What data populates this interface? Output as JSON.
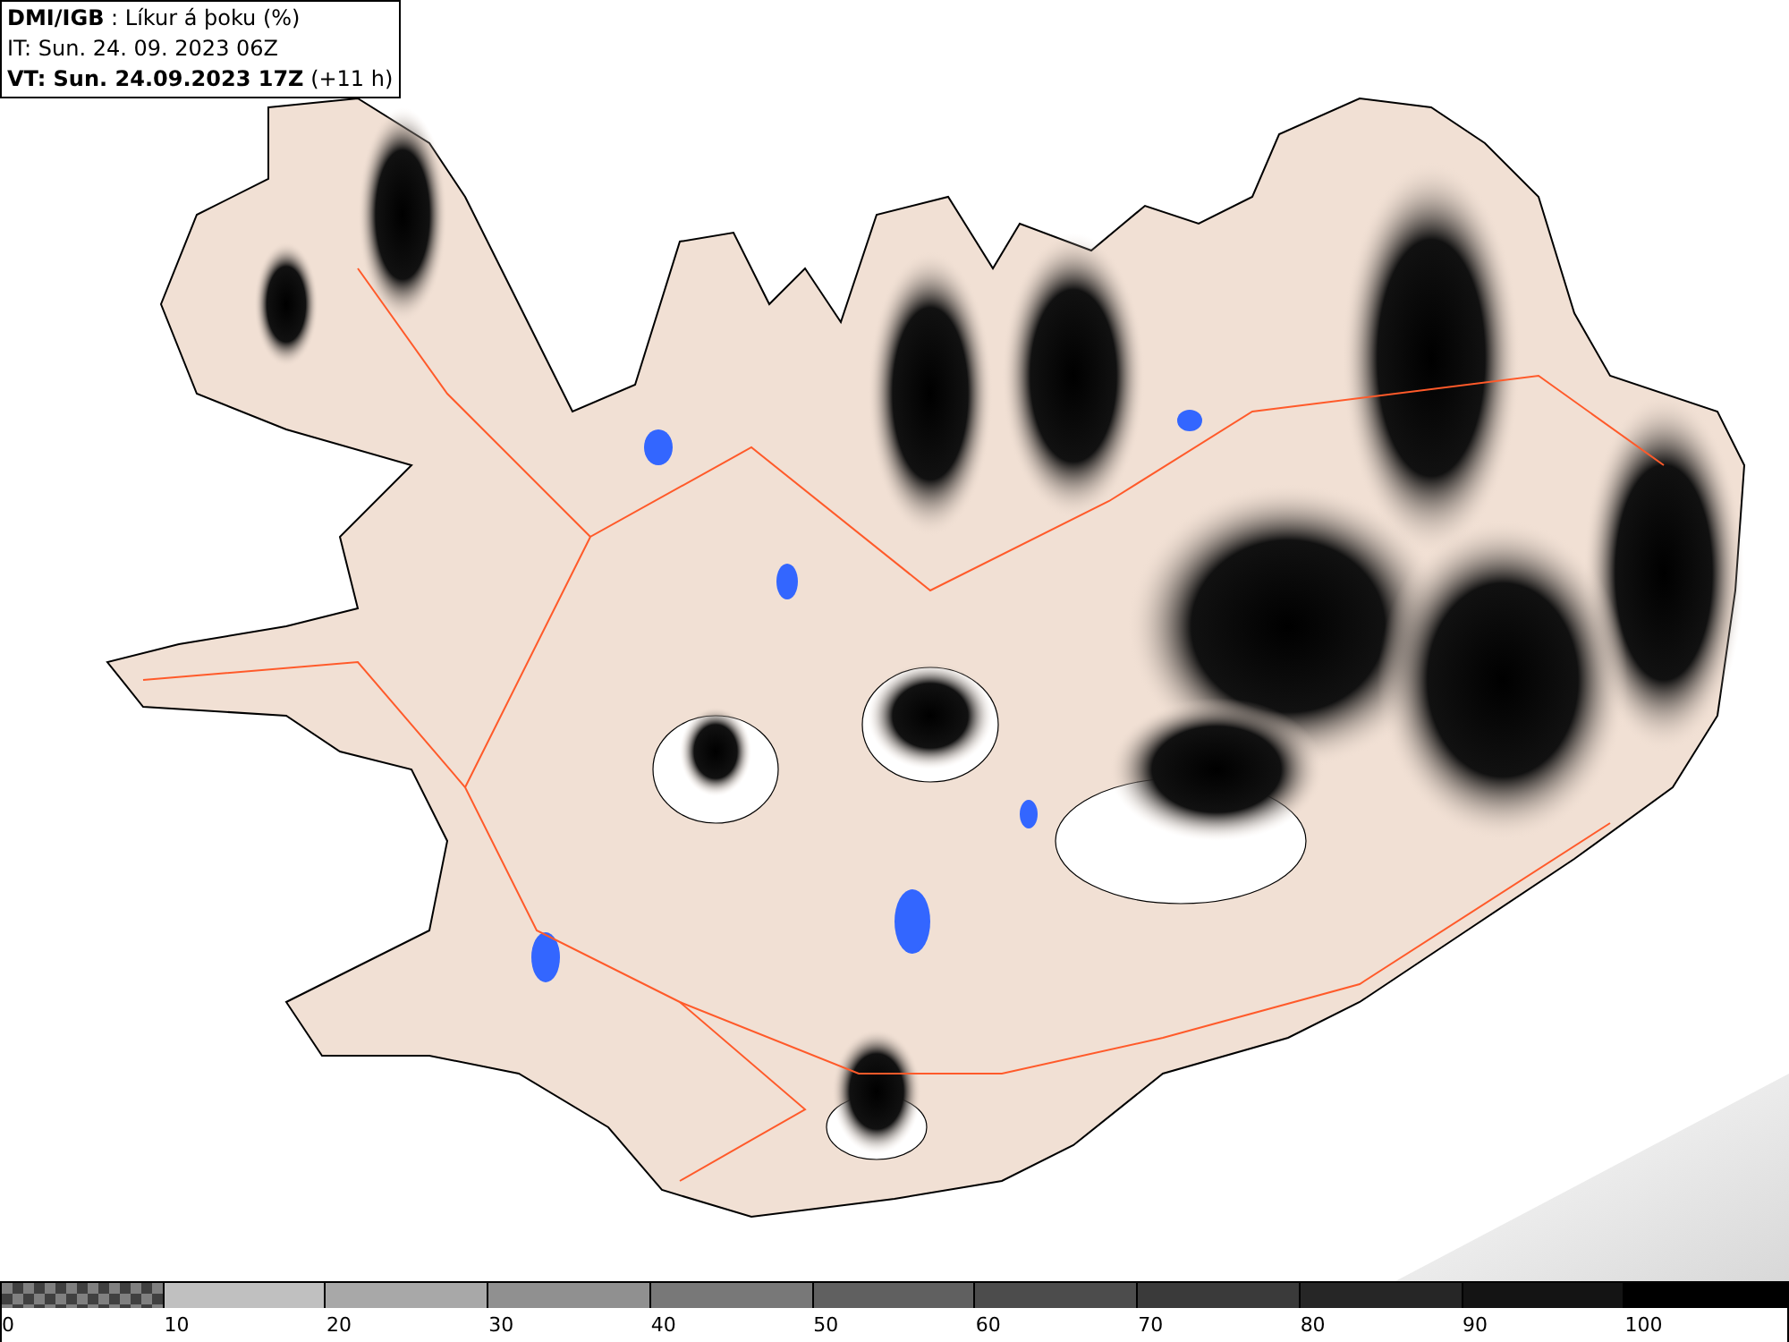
{
  "header": {
    "lines": [
      "**DMI/IGB** : Líkur á þoku (%)",
      "IT: Sun. 24. 09. 2023 06Z",
      "**VT: Sun. 24.09.2023 17Z** (+11 h)"
    ]
  },
  "legend": {
    "segments": [
      {
        "kind": "checker"
      },
      {
        "kind": "solid",
        "color": "#c0c0c0"
      },
      {
        "kind": "solid",
        "color": "#a8a8a8"
      },
      {
        "kind": "solid",
        "color": "#909090"
      },
      {
        "kind": "solid",
        "color": "#787878"
      },
      {
        "kind": "solid",
        "color": "#606060"
      },
      {
        "kind": "solid",
        "color": "#4c4c4c"
      },
      {
        "kind": "solid",
        "color": "#3a3a3a"
      },
      {
        "kind": "solid",
        "color": "#262626"
      },
      {
        "kind": "solid",
        "color": "#141414"
      },
      {
        "kind": "solid",
        "color": "#000000"
      }
    ],
    "labels": [
      "0",
      "10",
      "20",
      "30",
      "40",
      "50",
      "60",
      "70",
      "80",
      "90",
      "100"
    ]
  }
}
